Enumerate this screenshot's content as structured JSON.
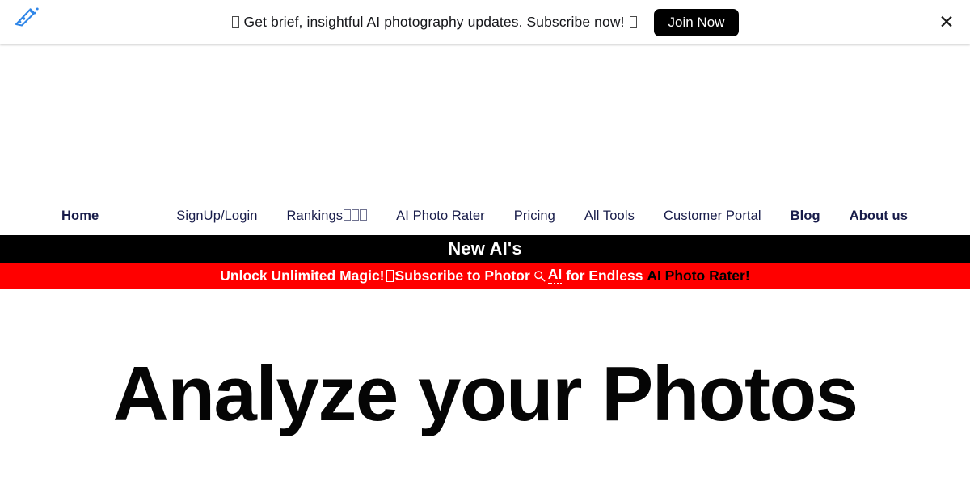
{
  "announcement": {
    "icon_left": "envelope-emoji",
    "text_before": "Get brief, insightful AI photography updates. Subscribe now!",
    "icon_right": "sparkle-emoji",
    "cta_label": "Join Now",
    "close_label": "✕",
    "logo_name": "flask-logo",
    "logo_color": "#2f86e8",
    "background": "#ffffff",
    "text_color": "#15161a",
    "cta_background": "#000000"
  },
  "nav": {
    "text_color": "#181c4a",
    "items": [
      {
        "label": "Home",
        "bold": true,
        "emoji_count": 0
      },
      {
        "label": "SignUp/Login",
        "bold": false,
        "emoji_count": 0
      },
      {
        "label": "Rankings",
        "bold": false,
        "emoji_count": 3
      },
      {
        "label": "AI Photo Rater",
        "bold": false,
        "emoji_count": 0
      },
      {
        "label": "Pricing",
        "bold": false,
        "emoji_count": 0
      },
      {
        "label": "All Tools",
        "bold": false,
        "emoji_count": 0
      },
      {
        "label": "Customer Portal",
        "bold": false,
        "emoji_count": 0
      },
      {
        "label": "Blog",
        "bold": true,
        "emoji_count": 0
      },
      {
        "label": "About us",
        "bold": true,
        "emoji_count": 0
      }
    ]
  },
  "black_strip": {
    "text": "New AI's",
    "background": "#000000",
    "color": "#ffffff"
  },
  "red_strip": {
    "background": "#ff0000",
    "part1": "Unlock Unlimited Magic!",
    "part2": "Subscribe to Photor",
    "icon": "magnifier-icon",
    "part3": "AI",
    "part4": "for Endless",
    "part5_highlight": "AI Photo Rater!",
    "white_color": "#ffffff",
    "highlight_color": "#000000"
  },
  "hero": {
    "title": "Analyze your Photos",
    "title_color": "#050505"
  }
}
